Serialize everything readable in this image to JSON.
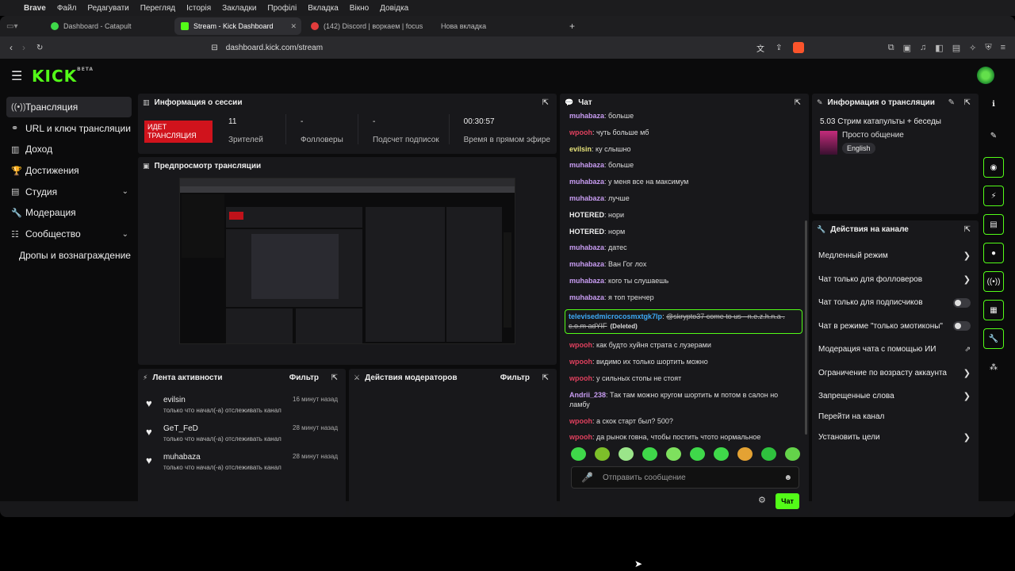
{
  "menubar": {
    "apple": "",
    "items": [
      "Brave",
      "Файл",
      "Редагувати",
      "Перегляд",
      "Історія",
      "Закладки",
      "Профілі",
      "Вкладка",
      "Вікно",
      "Довідка"
    ]
  },
  "tabs": [
    {
      "label": "Dashboard - Catapult",
      "color": "#3fd84a"
    },
    {
      "label": "Stream - Kick Dashboard",
      "color": "#53fc18"
    },
    {
      "label": "(142) Discord | воркаем | focus",
      "color": "#e23c3c"
    },
    {
      "label": "Нова вкладка",
      "color": "#555555"
    }
  ],
  "address": {
    "url": "dashboard.kick.com/stream",
    "lock_icon": "lock-icon"
  },
  "brand": {
    "logo": "KICK",
    "beta": "BETA",
    "accent": "#53fc18"
  },
  "nav": {
    "items": [
      {
        "label": "Трансляция",
        "icon": "((•))",
        "active": true
      },
      {
        "label": "URL и ключ трансляции",
        "icon": "⚭"
      },
      {
        "label": "Доход",
        "icon": "▥"
      },
      {
        "label": "Достижения",
        "icon": "🏆"
      },
      {
        "label": "Студия",
        "icon": "▤",
        "chevron": "⌄"
      },
      {
        "label": "Модерация",
        "icon": "🔧"
      },
      {
        "label": "Сообщество",
        "icon": "☷",
        "chevron": "⌄"
      },
      {
        "label": "Дропы и вознаграждение",
        "sub": true
      }
    ]
  },
  "session": {
    "title": "Информация о сессии",
    "live": "ИДЕТ ТРАНСЛЯЦИЯ",
    "stats": [
      {
        "value": "11",
        "label": "Зрителей"
      },
      {
        "value": "-",
        "label": "Фолловеры"
      },
      {
        "value": "-",
        "label": "Подсчет подписок"
      },
      {
        "value": "00:30:57",
        "label": "Время в прямом эфире"
      }
    ]
  },
  "preview": {
    "title": "Предпросмотр трансляции"
  },
  "feed": {
    "title": "Лента активности",
    "filter": "Фильтр",
    "items": [
      {
        "name": "evilsin",
        "desc": "только что начал(-а) отслеживать канал",
        "time": "16 минут назад"
      },
      {
        "name": "GeT_FeD",
        "desc": "только что начал(-а) отслеживать канал",
        "time": "28 минут назад"
      },
      {
        "name": "muhabaza",
        "desc": "только что начал(-а) отслеживать канал",
        "time": "28 минут назад"
      }
    ]
  },
  "modactions": {
    "title": "Действия модераторов",
    "filter": "Фильтр"
  },
  "chat": {
    "title": "Чат",
    "messages": [
      {
        "user": "muhabaza",
        "color": "#c89cf2",
        "text": "больше"
      },
      {
        "user": "wpooh",
        "color": "#e0405e",
        "text": "чуть больше мб"
      },
      {
        "user": "evilsin",
        "color": "#e7e37a",
        "text": "ку слышно"
      },
      {
        "user": "muhabaza",
        "color": "#c89cf2",
        "text": "больше"
      },
      {
        "user": "muhabaza",
        "color": "#c89cf2",
        "text": "у меня все на максимум"
      },
      {
        "user": "muhabaza",
        "color": "#c89cf2",
        "text": "лучше"
      },
      {
        "user": "HOTERED",
        "color": "#f0f0f0",
        "text": "нори"
      },
      {
        "user": "HOTERED",
        "color": "#f0f0f0",
        "text": "норм"
      },
      {
        "user": "muhabaza",
        "color": "#c89cf2",
        "text": "датес"
      },
      {
        "user": "muhabaza",
        "color": "#c89cf2",
        "text": "Ван Гог лох"
      },
      {
        "user": "muhabaza",
        "color": "#c89cf2",
        "text": "кого ты слушаешь"
      },
      {
        "user": "muhabaza",
        "color": "#c89cf2",
        "text": "я топ тренчер"
      }
    ],
    "deleted": {
      "user": "televisedmicrocosmxtgk7lp",
      "color": "#3da9f5",
      "text": "@skrypto37 come to us - n.e.z.h.n.a . c.o.m adYIF",
      "tag": "(Deleted)"
    },
    "messages2": [
      {
        "user": "wpooh",
        "color": "#e0405e",
        "text": "как будто хуйня страта с лузерами"
      },
      {
        "user": "wpooh",
        "color": "#e0405e",
        "text": "видимо их только шортить можно"
      },
      {
        "user": "wpooh",
        "color": "#e0405e",
        "text": "у сильных стопы не стоят"
      },
      {
        "user": "Andrii_238",
        "color": "#c89cf2",
        "text": "Так там можно кругом шортить м потом в салон но ламбу"
      },
      {
        "user": "wpooh",
        "color": "#e0405e",
        "text": "а скок старт был? 500?"
      },
      {
        "user": "wpooh",
        "color": "#e0405e",
        "text": "да рынок говна, чтобы постить чтото нормальное"
      }
    ],
    "placeholder": "Отправить сообщение",
    "send": "Чат"
  },
  "streaminfo": {
    "title": "Информация о трансляции",
    "stream_title": "5.03 Стрим катапульты + беседы",
    "category": "Просто общение",
    "language": "English"
  },
  "actions": {
    "title": "Действия на канале",
    "items": [
      {
        "label": "Медленный режим",
        "type": "arrow"
      },
      {
        "label": "Чат только для фолловеров",
        "type": "arrow"
      },
      {
        "label": "Чат только для подписчиков",
        "type": "toggle"
      },
      {
        "label": "Чат в режиме \"только эмотиконы\"",
        "type": "toggle"
      },
      {
        "label": "Модерация чата с помощью ИИ",
        "type": "ext"
      },
      {
        "label": "Ограничение по возрасту аккаунта",
        "type": "arrow"
      },
      {
        "label": "Запрещенные слова",
        "type": "arrow"
      },
      {
        "label": "Перейти на канал",
        "type": "none"
      },
      {
        "label": "Установить цели",
        "type": "arrow"
      }
    ]
  },
  "rail": [
    "info-icon",
    "pencil-icon",
    "camera-icon",
    "bolt-icon",
    "clipboard-icon",
    "chat-icon",
    "broadcast-icon",
    "id-card-icon",
    "wrench-icon",
    "community-icon"
  ]
}
